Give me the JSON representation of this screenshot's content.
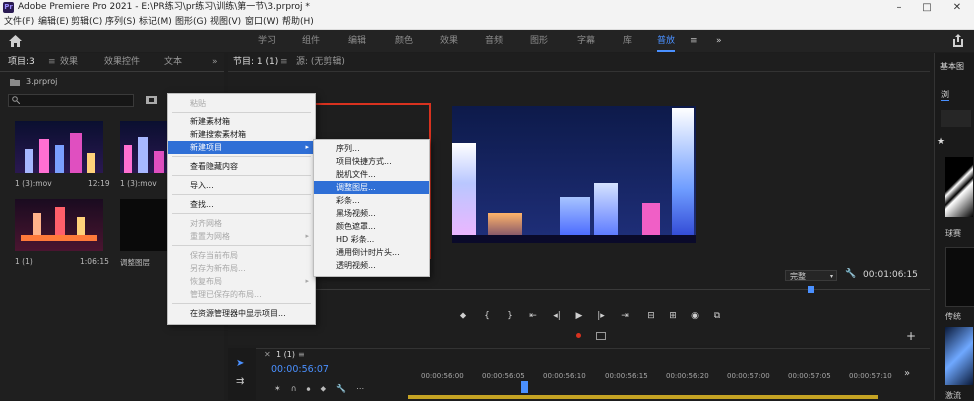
{
  "window": {
    "title": "Adobe Premiere Pro 2021 - E:\\PR练习\\pr练习\\训练\\第一节\\3.prproj *",
    "app_icon": "Pr",
    "minimize": "–",
    "maximize": "□",
    "close": "✕"
  },
  "menubar": [
    "文件(F)",
    "编辑(E)",
    "剪辑(C)",
    "序列(S)",
    "标记(M)",
    "图形(G)",
    "视图(V)",
    "窗口(W)",
    "帮助(H)"
  ],
  "workspaces": {
    "items": [
      "学习",
      "组件",
      "编辑",
      "颜色",
      "效果",
      "音频",
      "图形",
      "字幕",
      "库",
      "普放"
    ],
    "active_index": 9,
    "more": "»"
  },
  "project_panel": {
    "tabs": [
      "项目:3",
      "效果",
      "效果控件",
      "文本"
    ],
    "more": "»",
    "file_name": "3.prproj",
    "items": [
      {
        "name": "1 (3):mov",
        "duration": "12:19"
      },
      {
        "name": "1 (3):mov",
        "duration": ""
      },
      {
        "name": "1 (1)",
        "duration": "1:06:15"
      },
      {
        "name": "调整图层",
        "duration": ""
      }
    ]
  },
  "monitor": {
    "tabs": [
      "节目: 1 (1)",
      "源: (无剪辑)"
    ],
    "menu": "≡",
    "quality": "完整",
    "timecode": "00:01:06:15",
    "wrench_icon": "🔧",
    "add": "+",
    "transport": [
      "⬥",
      "{",
      "}",
      "⇤",
      "◂|",
      "▶",
      "|▸",
      "⇥",
      "⊟",
      "⊞",
      "◉",
      "⧉"
    ]
  },
  "context_menu": {
    "items": [
      {
        "label": "粘贴",
        "disabled": true
      },
      {
        "separator": true
      },
      {
        "label": "新建素材箱",
        "disabled": false
      },
      {
        "label": "新建搜索素材箱",
        "disabled": false
      },
      {
        "label": "新建项目",
        "disabled": false,
        "highlight": true,
        "submenu": true
      },
      {
        "separator": true
      },
      {
        "label": "查看隐藏内容",
        "disabled": false
      },
      {
        "separator": true
      },
      {
        "label": "导入...",
        "disabled": false
      },
      {
        "separator": true
      },
      {
        "label": "查找...",
        "disabled": false
      },
      {
        "separator": true
      },
      {
        "label": "对齐网格",
        "disabled": true
      },
      {
        "label": "重置为网格",
        "disabled": true,
        "submenu": true
      },
      {
        "separator": true
      },
      {
        "label": "保存当前布局",
        "disabled": true
      },
      {
        "label": "另存为新布局...",
        "disabled": true
      },
      {
        "label": "恢复布局",
        "disabled": true,
        "submenu": true
      },
      {
        "label": "管理已保存的布局...",
        "disabled": true
      },
      {
        "separator": true
      },
      {
        "label": "在资源管理器中显示项目...",
        "disabled": false
      }
    ]
  },
  "submenu": {
    "items": [
      {
        "label": "序列...",
        "highlight": false
      },
      {
        "label": "项目快捷方式...",
        "highlight": false
      },
      {
        "label": "脱机文件...",
        "highlight": false
      },
      {
        "label": "调整图层...",
        "highlight": true
      },
      {
        "label": "彩条...",
        "highlight": false
      },
      {
        "label": "黑场视频...",
        "highlight": false
      },
      {
        "label": "颜色遮罩...",
        "highlight": false
      },
      {
        "label": "HD 彩条...",
        "highlight": false
      },
      {
        "label": "通用倒计时片头...",
        "highlight": false
      },
      {
        "label": "透明视频...",
        "highlight": false
      }
    ]
  },
  "right_panel": {
    "title": "基本图",
    "tab": "浏",
    "star": "★",
    "labels": [
      "球赛",
      "传统",
      "激流"
    ]
  },
  "timeline": {
    "tab": "1 (1)",
    "menu": "≡",
    "close": "✕",
    "playhead": "00:00:56:07",
    "ruler": [
      "00:00:56:00",
      "00:00:56:05",
      "00:00:56:10",
      "00:00:56:15",
      "00:00:56:20",
      "00:00:57:00",
      "00:00:57:05",
      "00:00:57:10"
    ],
    "more": "»"
  },
  "colors": {
    "accent": "#4a90ff",
    "highlight": "#2f6fd6",
    "annotation": "#d8321f"
  }
}
